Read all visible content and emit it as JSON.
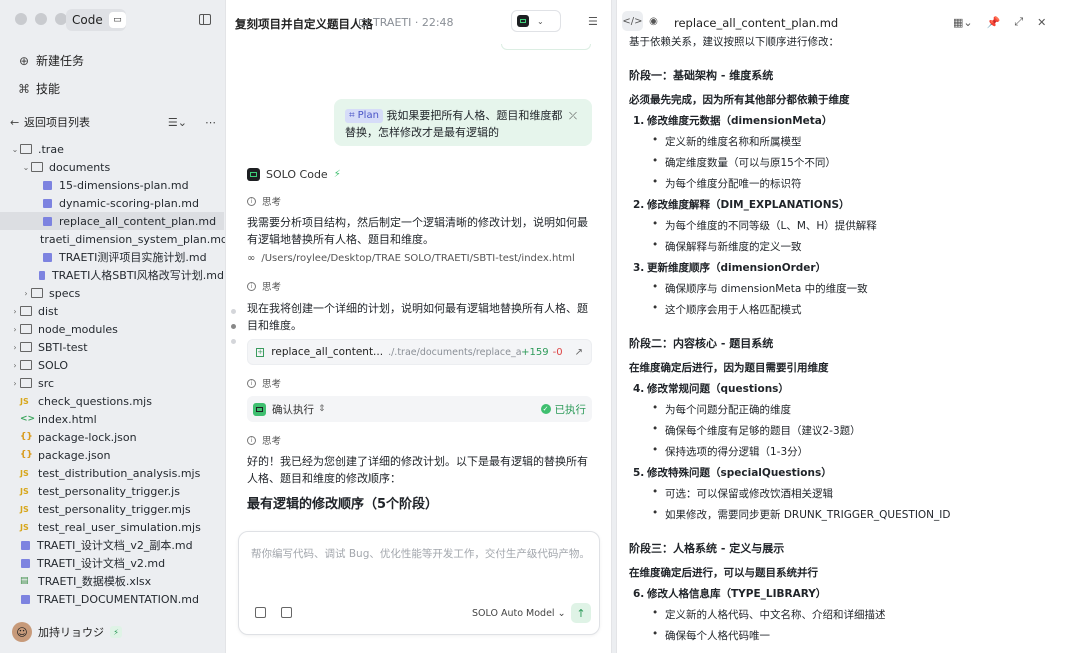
{
  "app": {
    "pill_label": "Code",
    "pill_icon": "code-icon"
  },
  "sidebar": {
    "new_task": "新建任务",
    "skills": "技能",
    "back": "返回项目列表",
    "tree": [
      {
        "label": ".trae",
        "type": "folder",
        "depth": 0,
        "expanded": true
      },
      {
        "label": "documents",
        "type": "folder",
        "depth": 1,
        "expanded": true
      },
      {
        "label": "15-dimensions-plan.md",
        "type": "md",
        "depth": 2
      },
      {
        "label": "dynamic-scoring-plan.md",
        "type": "md",
        "depth": 2
      },
      {
        "label": "replace_all_content_plan.md",
        "type": "md",
        "depth": 2,
        "selected": true
      },
      {
        "label": "traeti_dimension_system_plan.md",
        "type": "md",
        "depth": 2
      },
      {
        "label": "TRAETI测评项目实施计划.md",
        "type": "md",
        "depth": 2
      },
      {
        "label": "TRAETI人格SBTI风格改写计划.md",
        "type": "md",
        "depth": 2
      },
      {
        "label": "specs",
        "type": "folder",
        "depth": 1,
        "expanded": false
      },
      {
        "label": "dist",
        "type": "folder",
        "depth": 0,
        "expanded": false
      },
      {
        "label": "node_modules",
        "type": "folder",
        "depth": 0,
        "expanded": false
      },
      {
        "label": "SBTI-test",
        "type": "folder",
        "depth": 0,
        "expanded": false
      },
      {
        "label": "SOLO",
        "type": "folder",
        "depth": 0,
        "expanded": false
      },
      {
        "label": "src",
        "type": "folder",
        "depth": 0,
        "expanded": false
      },
      {
        "label": "check_questions.mjs",
        "type": "js",
        "depth": 0
      },
      {
        "label": "index.html",
        "type": "html",
        "depth": 0
      },
      {
        "label": "package-lock.json",
        "type": "json",
        "depth": 0
      },
      {
        "label": "package.json",
        "type": "json",
        "depth": 0
      },
      {
        "label": "test_distribution_analysis.mjs",
        "type": "js",
        "depth": 0
      },
      {
        "label": "test_personality_trigger.js",
        "type": "js",
        "depth": 0
      },
      {
        "label": "test_personality_trigger.mjs",
        "type": "js",
        "depth": 0
      },
      {
        "label": "test_real_user_simulation.mjs",
        "type": "js",
        "depth": 0
      },
      {
        "label": "TRAETI_设计文档_v2_副本.md",
        "type": "md",
        "depth": 0
      },
      {
        "label": "TRAETI_设计文档_v2.md",
        "type": "md",
        "depth": 0
      },
      {
        "label": "TRAETI_数据模板.xlsx",
        "type": "xlsx",
        "depth": 0
      },
      {
        "label": "TRAETI_DOCUMENTATION.md",
        "type": "md",
        "depth": 0
      }
    ],
    "user_name": "加持リョウジ"
  },
  "chat": {
    "title": "复刻项目并自定义题目人格",
    "subtitle": "TRAETI · 22:48",
    "plan_tag": "Plan",
    "user_message": "我如果要把所有人格、题目和维度都替换，怎样修改才是最有逻辑的",
    "agent_name": "SOLO Code",
    "think_label": "思考",
    "para1": "我需要分析项目结构，然后制定一个逻辑清晰的修改计划，说明如何最有逻辑地替换所有人格、题目和维度。",
    "link_path": "/Users/roylee/Desktop/TRAE SOLO/TRAETI/SBTI-test/index.html",
    "para2": "现在我将创建一个详细的计划，说明如何最有逻辑地替换所有人格、题目和维度。",
    "file_card": {
      "name": "replace_all_content...",
      "path": "./.trae/documents/replace_all_co...",
      "added": "+159",
      "removed": "-0"
    },
    "exec_label": "确认执行",
    "exec_status": "已执行",
    "para3": "好的！我已经为您创建了详细的修改计划。以下是最有逻辑的替换所有人格、题目和维度的修改顺序：",
    "heading": "最有逻辑的修改顺序（5个阶段）",
    "input_placeholder": "帮你编写代码、调试 Bug、优化性能等开发工作，交付生产级代码产物。",
    "model": "SOLO Auto Model"
  },
  "doc": {
    "title": "replace_all_content_plan.md",
    "lines": [
      {
        "kind": "p",
        "text": "基于依赖关系，建议按照以下顺序进行修改："
      },
      {
        "kind": "h",
        "text": "阶段一：基础架构 - 维度系统"
      },
      {
        "kind": "b",
        "text": "必须最先完成，因为所有其他部分都依赖于维度"
      },
      {
        "kind": "o",
        "num": "1.",
        "text": "修改维度元数据（dimensionMeta）"
      },
      {
        "kind": "u",
        "text": "定义新的维度名称和所属模型"
      },
      {
        "kind": "u",
        "text": "确定维度数量（可以与原15个不同）"
      },
      {
        "kind": "u",
        "text": "为每个维度分配唯一的标识符"
      },
      {
        "kind": "o",
        "num": "2.",
        "text": "修改维度解释（DIM_EXPLANATIONS）"
      },
      {
        "kind": "u",
        "text": "为每个维度的不同等级（L、M、H）提供解释"
      },
      {
        "kind": "u",
        "text": "确保解释与新维度的定义一致"
      },
      {
        "kind": "o",
        "num": "3.",
        "text": "更新维度顺序（dimensionOrder）"
      },
      {
        "kind": "u",
        "text": "确保顺序与 dimensionMeta 中的维度一致"
      },
      {
        "kind": "u",
        "text": "这个顺序会用于人格匹配模式"
      },
      {
        "kind": "h",
        "text": "阶段二：内容核心 - 题目系统"
      },
      {
        "kind": "b",
        "text": "在维度确定后进行，因为题目需要引用维度"
      },
      {
        "kind": "o",
        "num": "4.",
        "text": "修改常规问题（questions）"
      },
      {
        "kind": "u",
        "text": "为每个问题分配正确的维度"
      },
      {
        "kind": "u",
        "text": "确保每个维度有足够的题目（建议2-3题）"
      },
      {
        "kind": "u",
        "text": "保持选项的得分逻辑（1-3分）"
      },
      {
        "kind": "o",
        "num": "5.",
        "text": "修改特殊问题（specialQuestions）"
      },
      {
        "kind": "u",
        "text": "可选：可以保留或修改饮酒相关逻辑"
      },
      {
        "kind": "u",
        "text": "如果修改，需要同步更新 DRUNK_TRIGGER_QUESTION_ID"
      },
      {
        "kind": "h",
        "text": "阶段三：人格系统 - 定义与展示"
      },
      {
        "kind": "b",
        "text": "在维度确定后进行，可以与题目系统并行"
      },
      {
        "kind": "o",
        "num": "6.",
        "text": "修改人格信息库（TYPE_LIBRARY）"
      },
      {
        "kind": "u",
        "text": "定义新的人格代码、中文名称、介绍和详细描述"
      },
      {
        "kind": "u",
        "text": "确保每个人格代码唯一"
      }
    ]
  }
}
